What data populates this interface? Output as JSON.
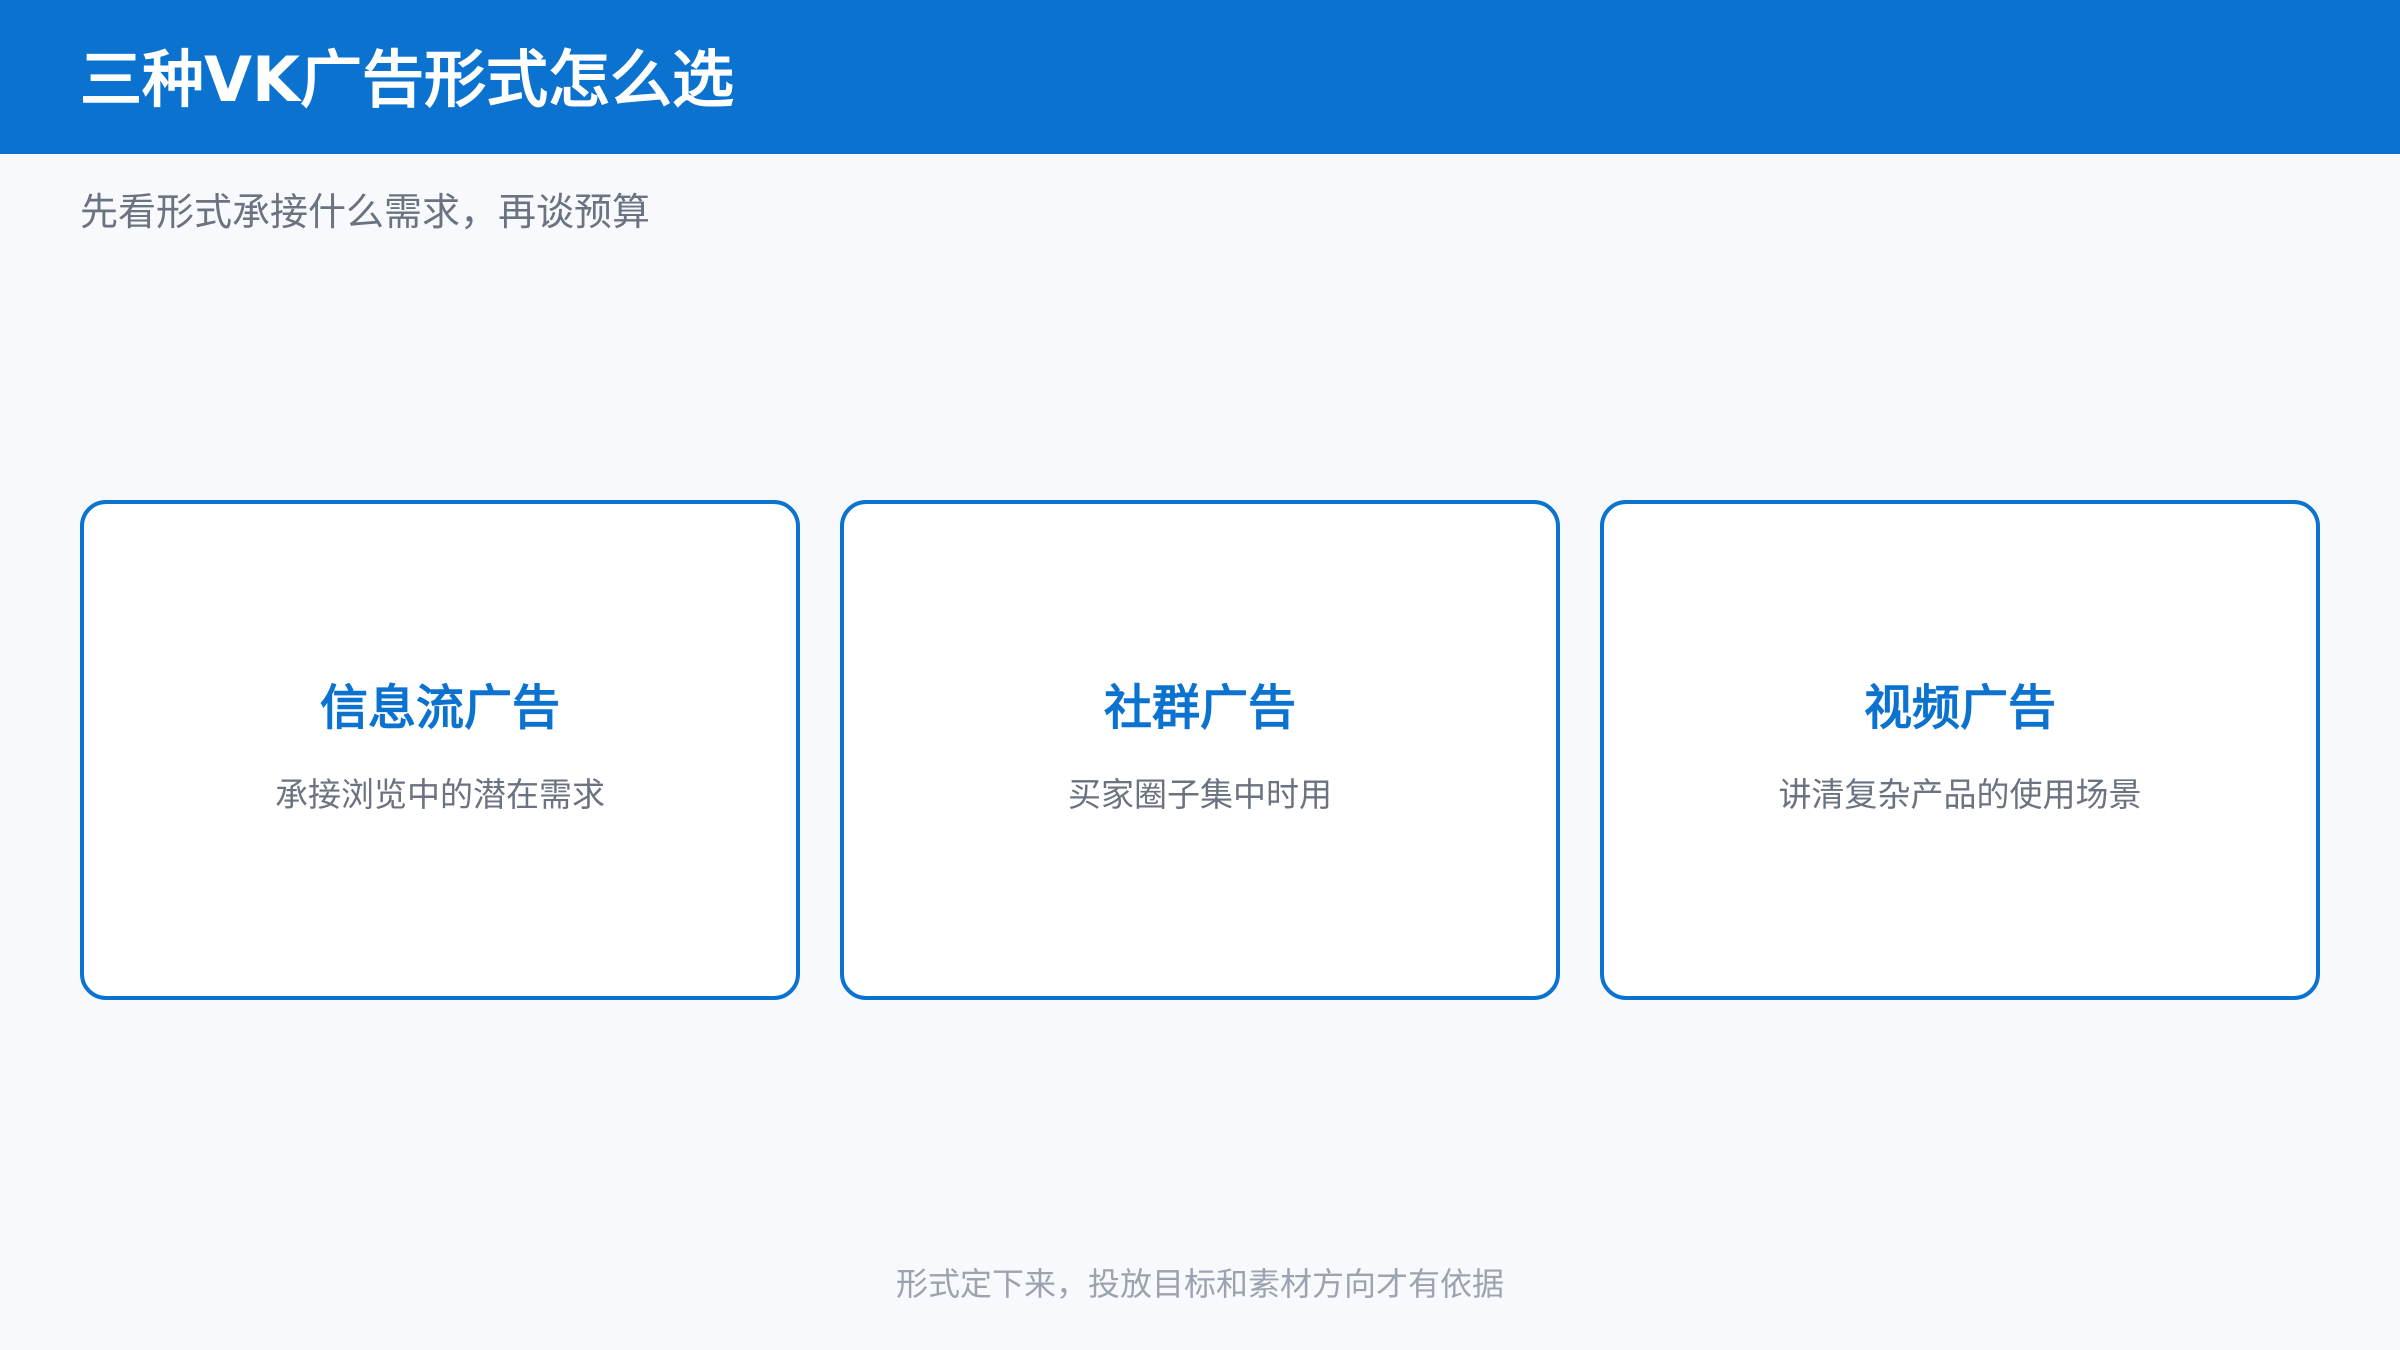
{
  "header": {
    "title": "三种VK广告形式怎么选"
  },
  "subtitle": "先看形式承接什么需求，再谈预算",
  "cards": [
    {
      "title": "信息流广告",
      "description": "承接浏览中的潜在需求"
    },
    {
      "title": "社群广告",
      "description": "买家圈子集中时用"
    },
    {
      "title": "视频广告",
      "description": "讲清复杂产品的使用场景"
    }
  ],
  "footer": {
    "note": "形式定下来，投放目标和素材方向才有依据"
  },
  "colors": {
    "accent": "#0b72d0",
    "background": "#f7f9fc",
    "card_background": "#ffffff",
    "muted_text": "#6b7280",
    "light_text": "#9ca3af"
  }
}
